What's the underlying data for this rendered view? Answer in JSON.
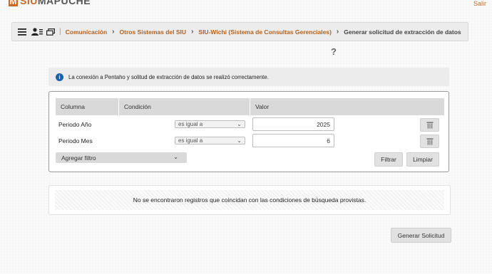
{
  "app": {
    "logo_prefix": "SIU",
    "logo_name": "MAPUCHE",
    "logo_letter": "M",
    "logout": "Salir"
  },
  "nav": {
    "separator": "|",
    "breadcrumbs": [
      {
        "label": "Comunicación"
      },
      {
        "label": "Otros Sistemas del SIU"
      },
      {
        "label": "SIU-Wichi (Sistema de Consultas Gerenciales)"
      },
      {
        "label": "Generar solicitud de extracción de datos"
      }
    ],
    "icons": [
      "menu-icon",
      "users-icon",
      "windows-icon"
    ]
  },
  "help": "?",
  "message": {
    "icon": "info-icon",
    "text": "La conexión a Pentaho y solitud de extracción de datos se realizó correctamente."
  },
  "filters": {
    "columns": [
      "Columna",
      "Condición",
      "Valor"
    ],
    "rows": [
      {
        "column": "Periodo Año",
        "condition": "es igual a",
        "value": "2025"
      },
      {
        "column": "Periodo Mes",
        "condition": "es igual a",
        "value": "6"
      }
    ],
    "add_filter": "Agregar filtro",
    "filter_button": "Filtrar",
    "clear_button": "Limpiar"
  },
  "results": {
    "empty_text": "No se encontraron registros que coincidan con las condiciones de búsqueda provistas."
  },
  "actions": {
    "generate": "Generar Solicitud"
  },
  "colors": {
    "brand": "#c46a2a",
    "link": "#b3611f",
    "info": "#1f5fa8"
  }
}
